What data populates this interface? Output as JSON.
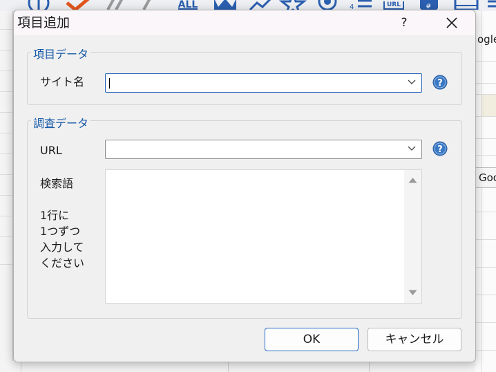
{
  "dialog": {
    "title": "項目追加",
    "help_label": "?",
    "close_icon": "close-icon"
  },
  "item_group": {
    "label": "項目データ",
    "site_name_label": "サイト名",
    "site_name_value": ""
  },
  "survey_group": {
    "label": "調査データ",
    "url_label": "URL",
    "url_value": "",
    "keywords_label": "検索語",
    "keywords_hint": [
      "1行に",
      "1つずつ",
      "入力して",
      "ください"
    ],
    "keywords_value": ""
  },
  "buttons": {
    "ok": "OK",
    "cancel": "キャンセル"
  },
  "background": {
    "partial_text_1": "ogle",
    "partial_button": "Goo",
    "toolbar_partial_text": "ALL",
    "toolbar_partial_url": "URL"
  },
  "colors": {
    "accent": "#2a66b8",
    "group_label": "#1558a8",
    "help_icon": "#3b78c3",
    "toolbar_check": "#e2561d"
  },
  "icons": [
    "close-icon",
    "help-circle-icon",
    "chevron-down-icon",
    "scroll-up-arrow-icon",
    "scroll-down-arrow-icon"
  ]
}
